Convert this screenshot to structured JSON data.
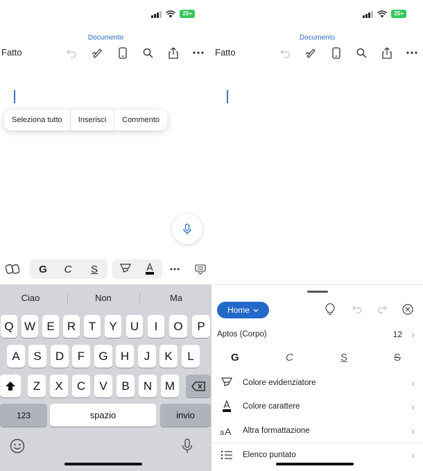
{
  "status": {
    "battery": "25+"
  },
  "left": {
    "doc_title": "Documento",
    "done_label": "Fatto",
    "context_menu": [
      "Seleziona tutto",
      "Inserisci",
      "Commento"
    ],
    "format_bar": {
      "bold": "G",
      "italic": "C",
      "underline": "S"
    },
    "keyboard": {
      "suggestions": [
        "Ciao",
        "Non",
        "Ma"
      ],
      "row1": [
        "Q",
        "W",
        "E",
        "R",
        "T",
        "Y",
        "U",
        "I",
        "O",
        "P"
      ],
      "row2": [
        "A",
        "S",
        "D",
        "F",
        "G",
        "H",
        "J",
        "K",
        "L"
      ],
      "row3": [
        "Z",
        "X",
        "C",
        "V",
        "B",
        "N",
        "M"
      ],
      "numbers_key": "123",
      "space_key": "spazio",
      "return_key": "invio"
    }
  },
  "right": {
    "doc_title": "Documento",
    "done_label": "Fatto",
    "sheet": {
      "tab_label": "Home",
      "font_name": "Aptos (Corpo)",
      "font_size": "12",
      "bold": "G",
      "italic": "C",
      "underline": "S",
      "strike": "S",
      "items": [
        {
          "label": "Colore evidenziatore",
          "icon": "highlighter-icon"
        },
        {
          "label": "Colore carattere",
          "icon": "font-color-icon"
        },
        {
          "label": "Altra formattazione",
          "icon": "font-size-icon"
        },
        {
          "label": "Elenco puntato",
          "icon": "bullet-list-icon"
        }
      ]
    }
  }
}
